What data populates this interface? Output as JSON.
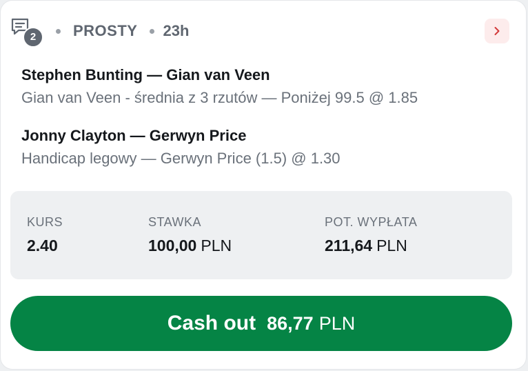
{
  "colors": {
    "cashout_bg": "#058445",
    "chevron_accent": "#d33a3a",
    "chevron_bg": "#fdecec",
    "summary_bg": "#eef0f2",
    "muted_text": "#6a717a"
  },
  "header": {
    "icon": "ticket-chat-icon",
    "selection_count": "2",
    "bet_type": "PROSTY",
    "time": "23h",
    "chevron_icon": "chevron-right-icon"
  },
  "selections": [
    {
      "match": "Stephen Bunting — Gian van Veen",
      "market": "Gian van Veen - średnia z 3 rzutów — Poniżej 99.5 @ 1.85"
    },
    {
      "match": "Jonny Clayton — Gerwyn Price",
      "market": "Handicap legowy — Gerwyn Price (1.5) @ 1.30"
    }
  ],
  "summary": {
    "odds_label": "KURS",
    "odds_value": "2.40",
    "stake_label": "STAWKA",
    "stake_value": "100,00",
    "stake_currency": "PLN",
    "payout_label": "POT. WYPŁATA",
    "payout_value": "211,64",
    "payout_currency": "PLN"
  },
  "cashout": {
    "label": "Cash out",
    "amount": "86,77",
    "currency": "PLN"
  }
}
